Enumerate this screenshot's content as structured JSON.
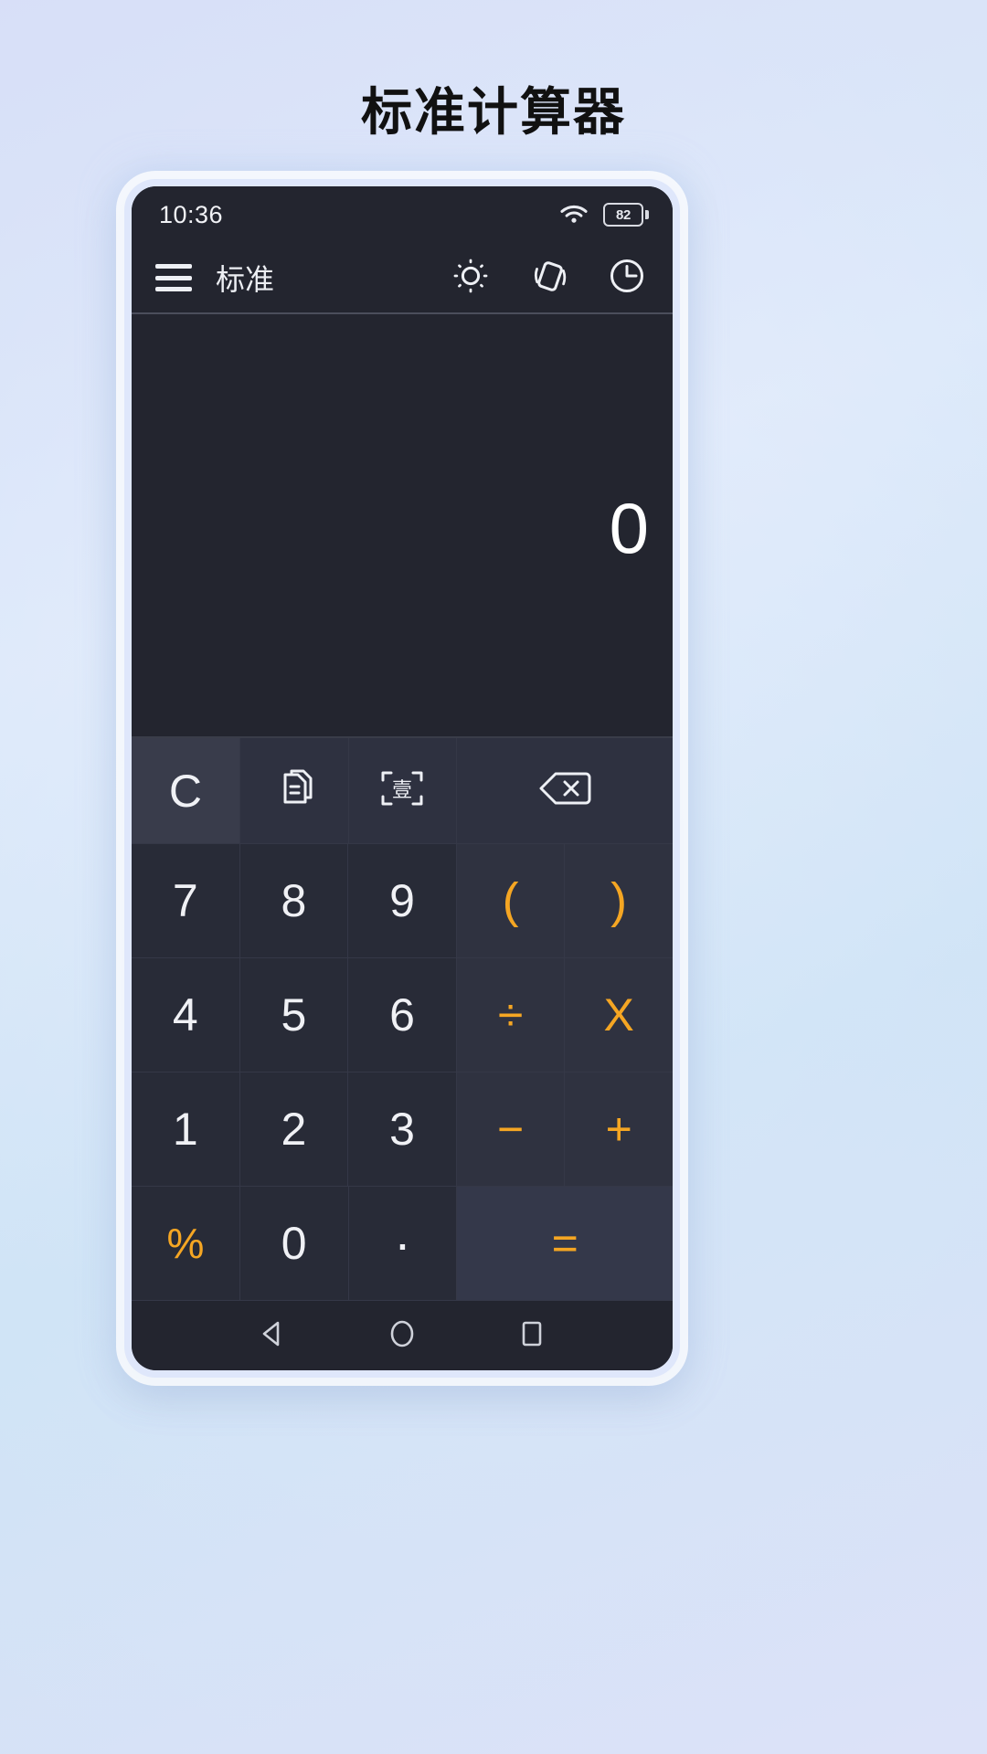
{
  "page": {
    "title": "标准计算器",
    "accent_color": "#f5a623",
    "screen_bg": "#23252f",
    "keypad_bg": "#282b37",
    "text_color": "#f0f1f5"
  },
  "status_bar": {
    "time": "10:36",
    "wifi_icon": "wifi-icon",
    "battery_level": "82",
    "battery_icon": "battery-icon"
  },
  "app_bar": {
    "menu_icon": "hamburger-menu-icon",
    "title": "标准",
    "actions": [
      {
        "name": "brightness-icon",
        "label": "亮度"
      },
      {
        "name": "rotate-screen-icon",
        "label": "旋转屏幕"
      },
      {
        "name": "history-clock-icon",
        "label": "历史记录"
      }
    ]
  },
  "display": {
    "expression": "",
    "result": "0"
  },
  "function_row": [
    {
      "name": "clear-button",
      "label": "C",
      "kind": "text",
      "style": "clear"
    },
    {
      "name": "copy-button",
      "label": "",
      "kind": "icon-copy",
      "style": "fn"
    },
    {
      "name": "chinese-numeral-button",
      "label": "壹",
      "kind": "icon-scan-cn",
      "style": "fn"
    },
    {
      "name": "backspace-button",
      "label": "",
      "kind": "icon-backspace",
      "style": "wide"
    }
  ],
  "keypad": [
    [
      {
        "name": "key-7",
        "label": "7",
        "type": "num"
      },
      {
        "name": "key-8",
        "label": "8",
        "type": "num"
      },
      {
        "name": "key-9",
        "label": "9",
        "type": "num"
      },
      {
        "name": "key-open-paren",
        "label": "(",
        "type": "paren"
      },
      {
        "name": "key-close-paren",
        "label": ")",
        "type": "paren"
      }
    ],
    [
      {
        "name": "key-4",
        "label": "4",
        "type": "num"
      },
      {
        "name": "key-5",
        "label": "5",
        "type": "num"
      },
      {
        "name": "key-6",
        "label": "6",
        "type": "num"
      },
      {
        "name": "key-divide",
        "label": "÷",
        "type": "op"
      },
      {
        "name": "key-multiply",
        "label": "X",
        "type": "op"
      }
    ],
    [
      {
        "name": "key-1",
        "label": "1",
        "type": "num"
      },
      {
        "name": "key-2",
        "label": "2",
        "type": "num"
      },
      {
        "name": "key-3",
        "label": "3",
        "type": "num"
      },
      {
        "name": "key-minus",
        "label": "−",
        "type": "op"
      },
      {
        "name": "key-plus",
        "label": "+",
        "type": "op"
      }
    ],
    [
      {
        "name": "key-percent",
        "label": "%",
        "type": "pct"
      },
      {
        "name": "key-0",
        "label": "0",
        "type": "num"
      },
      {
        "name": "key-decimal",
        "label": "·",
        "type": "dot"
      },
      {
        "name": "key-equals",
        "label": "=",
        "type": "eq"
      }
    ]
  ],
  "nav_bar": [
    {
      "name": "nav-back-button",
      "label": "返回"
    },
    {
      "name": "nav-home-button",
      "label": "主页"
    },
    {
      "name": "nav-recents-button",
      "label": "最近任务"
    }
  ]
}
